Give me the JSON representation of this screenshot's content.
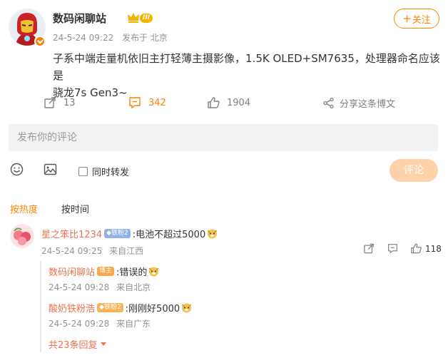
{
  "post": {
    "author": "数码闲聊站",
    "level_badge": "III",
    "time": "24-5-24 09:22",
    "location": "发布于 北京",
    "follow_label": "关注",
    "follow_plus": "+",
    "text_line1": "子系中端走量机依旧主打轻薄主摄影像，1.5K OLED+SM7635，处理器命名应该是",
    "text_line2": "骁龙7s Gen3~"
  },
  "actions": {
    "repost_count": "13",
    "comment_count": "342",
    "like_count": "1904",
    "share_label": "分享这条博文"
  },
  "composer": {
    "placeholder": "发布你的评论",
    "repost_label": "同时转发",
    "submit_label": "评论"
  },
  "sort": {
    "hot": "按热度",
    "time": "按时间"
  },
  "comments": [
    {
      "name": "星之笨比1234",
      "badge": "铁粉2",
      "text": ":电池不超过5000",
      "time": "24-5-24 09:25",
      "location": "来自江西",
      "likes": "118"
    }
  ],
  "replies": [
    {
      "name": "数码闲聊站",
      "badge": "博主",
      "text": ":错误的",
      "time": "24-5-24 09:28",
      "location": "来自北京"
    },
    {
      "name": "酸奶铁粉浩",
      "badge": "铁粉2",
      "text": ":刚刚好5000",
      "time": "24-5-24 09:28",
      "location": "来自广东"
    }
  ],
  "more_replies": "共23条回复",
  "colors": {
    "accent": "#ff8200",
    "name": "#eb7350",
    "muted": "#939393"
  }
}
